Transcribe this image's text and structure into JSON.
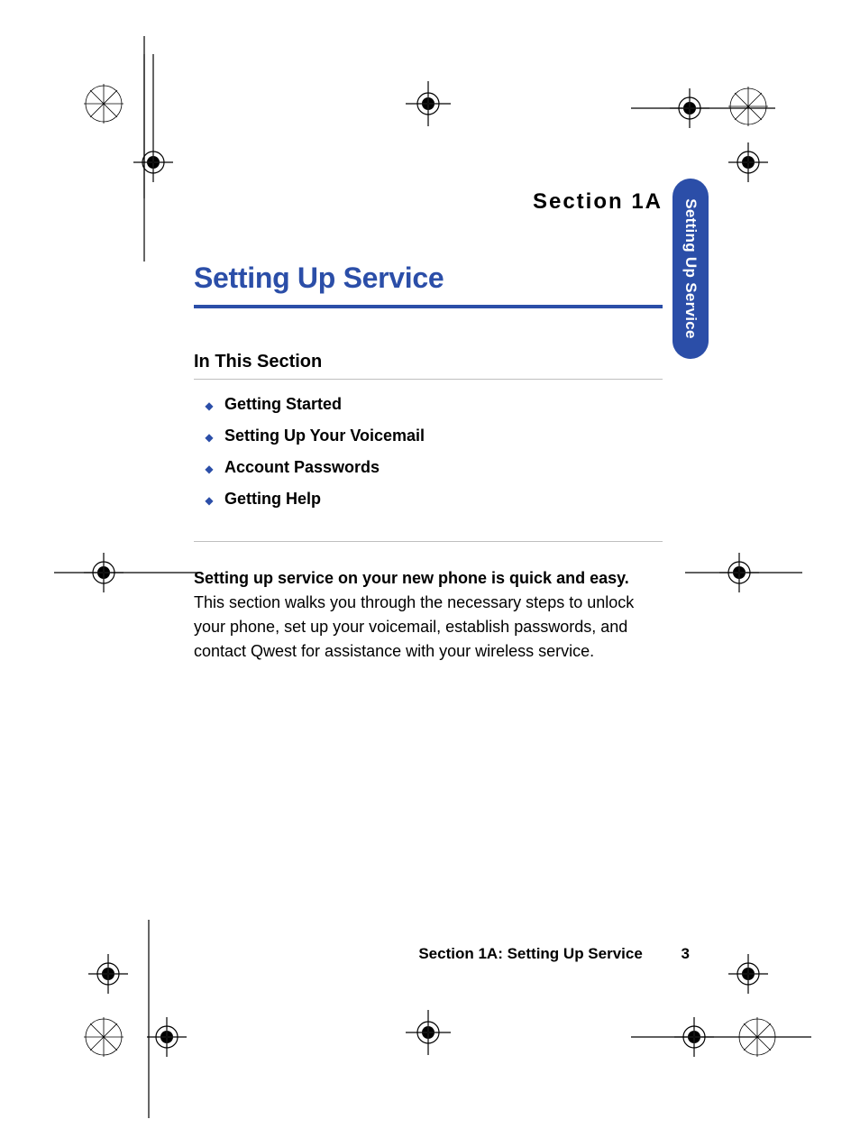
{
  "section_label": "Section 1A",
  "title": "Setting Up Service",
  "in_this_section": "In This Section",
  "bullets": [
    "Getting Started",
    "Setting Up Your Voicemail",
    "Account Passwords",
    "Getting Help"
  ],
  "body": {
    "lead": "Setting up service on your new phone is quick and easy.",
    "rest": " This section walks you through the necessary steps to unlock your phone, set up your voicemail, establish passwords, and contact Qwest for assistance with your wireless service."
  },
  "footer": {
    "label": "Section 1A: Setting Up Service",
    "page": "3"
  },
  "side_tab": "Setting Up Service",
  "colors": {
    "accent": "#2b4ea8"
  }
}
